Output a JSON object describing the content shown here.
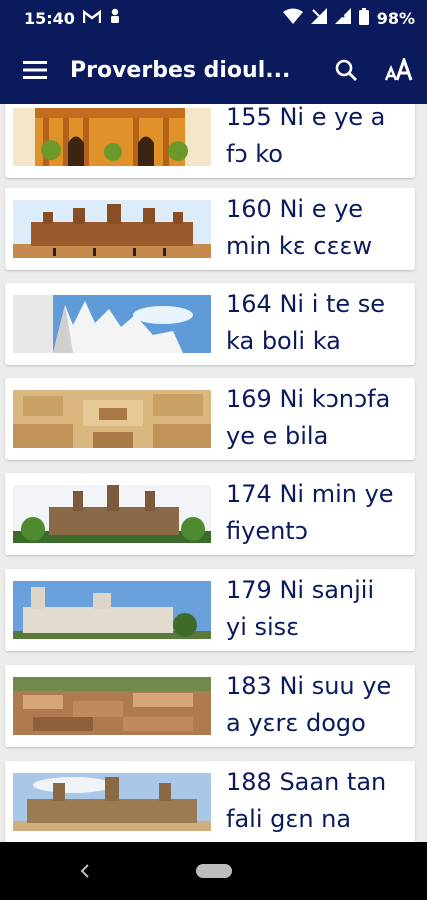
{
  "status": {
    "time": "15:40",
    "battery": "98%"
  },
  "app": {
    "title": "Proverbes dioul..."
  },
  "items": [
    {
      "line1": "155 Ni e ye a",
      "line2": "fɔ ko"
    },
    {
      "line1": "160 Ni e ye",
      "line2": "min kɛ cɛɛw"
    },
    {
      "line1": "164 Ni i te se",
      "line2": "ka boli ka"
    },
    {
      "line1": "169 Ni kɔnɔfa",
      "line2": "ye e bila"
    },
    {
      "line1": "174 Ni min ye",
      "line2": "fiyentɔ"
    },
    {
      "line1": "179 Ni sanjii",
      "line2": "yi sisɛ"
    },
    {
      "line1": "183 Ni suu ye",
      "line2": "a yɛrɛ dogo"
    },
    {
      "line1": "188 Saan tan",
      "line2": "fali gɛn na"
    }
  ],
  "colors": {
    "brand": "#0b1a5c",
    "card_text": "#0b1a5c"
  }
}
